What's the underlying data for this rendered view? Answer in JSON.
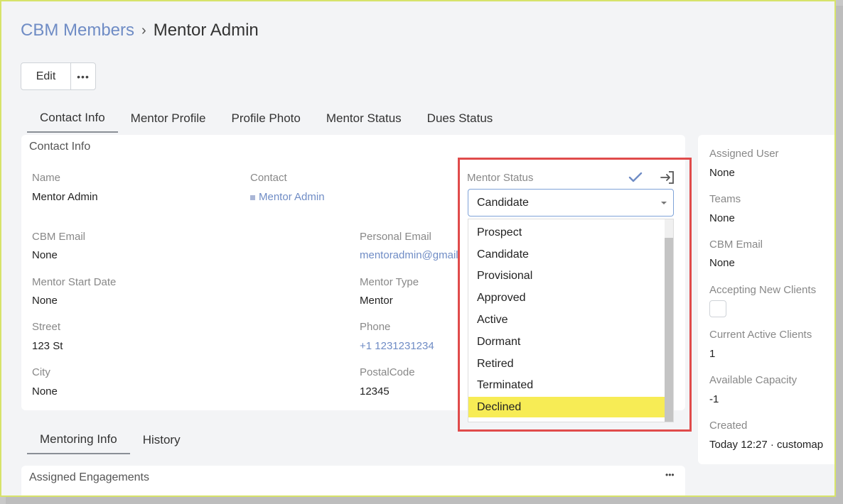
{
  "breadcrumb": {
    "parent": "CBM Members",
    "current": "Mentor Admin"
  },
  "toolbar": {
    "edit_label": "Edit",
    "more_label": "•••"
  },
  "tabs_top": [
    "Contact Info",
    "Mentor Profile",
    "Profile Photo",
    "Mentor Status",
    "Dues Status"
  ],
  "contact_panel": {
    "title": "Contact Info",
    "name_label": "Name",
    "name_value": "Mentor Admin",
    "contact_label": "Contact",
    "contact_value": "Mentor Admin",
    "cbm_email_label": "CBM Email",
    "cbm_email_value": "None",
    "personal_email_label": "Personal Email",
    "personal_email_value": "mentoradmin@gmail",
    "start_date_label": "Mentor Start Date",
    "start_date_value": "None",
    "mentor_type_label": "Mentor Type",
    "mentor_type_value": "Mentor",
    "street_label": "Street",
    "street_value": "123 St",
    "phone_label": "Phone",
    "phone_value": "+1 1231231234",
    "city_label": "City",
    "city_value": "None",
    "postal_label": "PostalCode",
    "postal_value": "12345"
  },
  "mentor_status": {
    "label": "Mentor Status",
    "selected": "Candidate",
    "options": [
      "Prospect",
      "Candidate",
      "Provisional",
      "Approved",
      "Active",
      "Dormant",
      "Retired",
      "Terminated",
      "Declined"
    ],
    "hover_option": "Declined"
  },
  "side_panel": {
    "assigned_user_label": "Assigned User",
    "assigned_user_value": "None",
    "teams_label": "Teams",
    "teams_value": "None",
    "cbm_email_label": "CBM Email",
    "cbm_email_value": "None",
    "accepting_label": "Accepting New Clients",
    "active_clients_label": "Current Active Clients",
    "active_clients_value": "1",
    "capacity_label": "Available Capacity",
    "capacity_value": "-1",
    "created_label": "Created",
    "created_value": "Today 12:27 · customap"
  },
  "tabs_bottom": [
    "Mentoring Info",
    "History"
  ],
  "engagements": {
    "title": "Assigned Engagements",
    "more_label": "•••"
  },
  "colors": {
    "link": "#6f8cc5",
    "highlight": "#e04b4b",
    "hover": "#f7ec55"
  }
}
